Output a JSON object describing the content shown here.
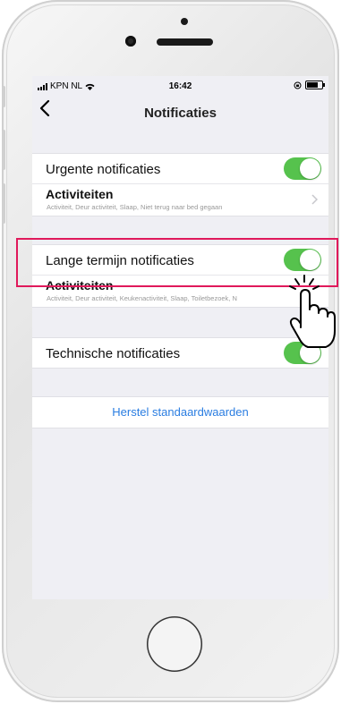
{
  "status_bar": {
    "carrier": "KPN NL",
    "time": "16:42"
  },
  "nav": {
    "title": "Notificaties",
    "back_icon": "chevron-left-icon"
  },
  "sections": [
    {
      "toggle_label": "Urgente notificaties",
      "toggle_on": true,
      "sub_label": "Activiteiten",
      "sub_desc": "Activiteit, Deur activiteit, Slaap, Niet terug naar bed gegaan"
    },
    {
      "toggle_label": "Lange termijn notificaties",
      "toggle_on": true,
      "sub_label": "Activiteiten",
      "sub_desc": "Activiteit, Deur activiteit, Keukenactiviteit, Slaap, Toiletbezoek, N"
    },
    {
      "toggle_label": "Technische notificaties",
      "toggle_on": true
    }
  ],
  "reset_button": "Herstel standaardwaarden",
  "colors": {
    "toggle_on": "#56c24d",
    "link": "#2a7de1",
    "highlight": "#e0195b"
  }
}
